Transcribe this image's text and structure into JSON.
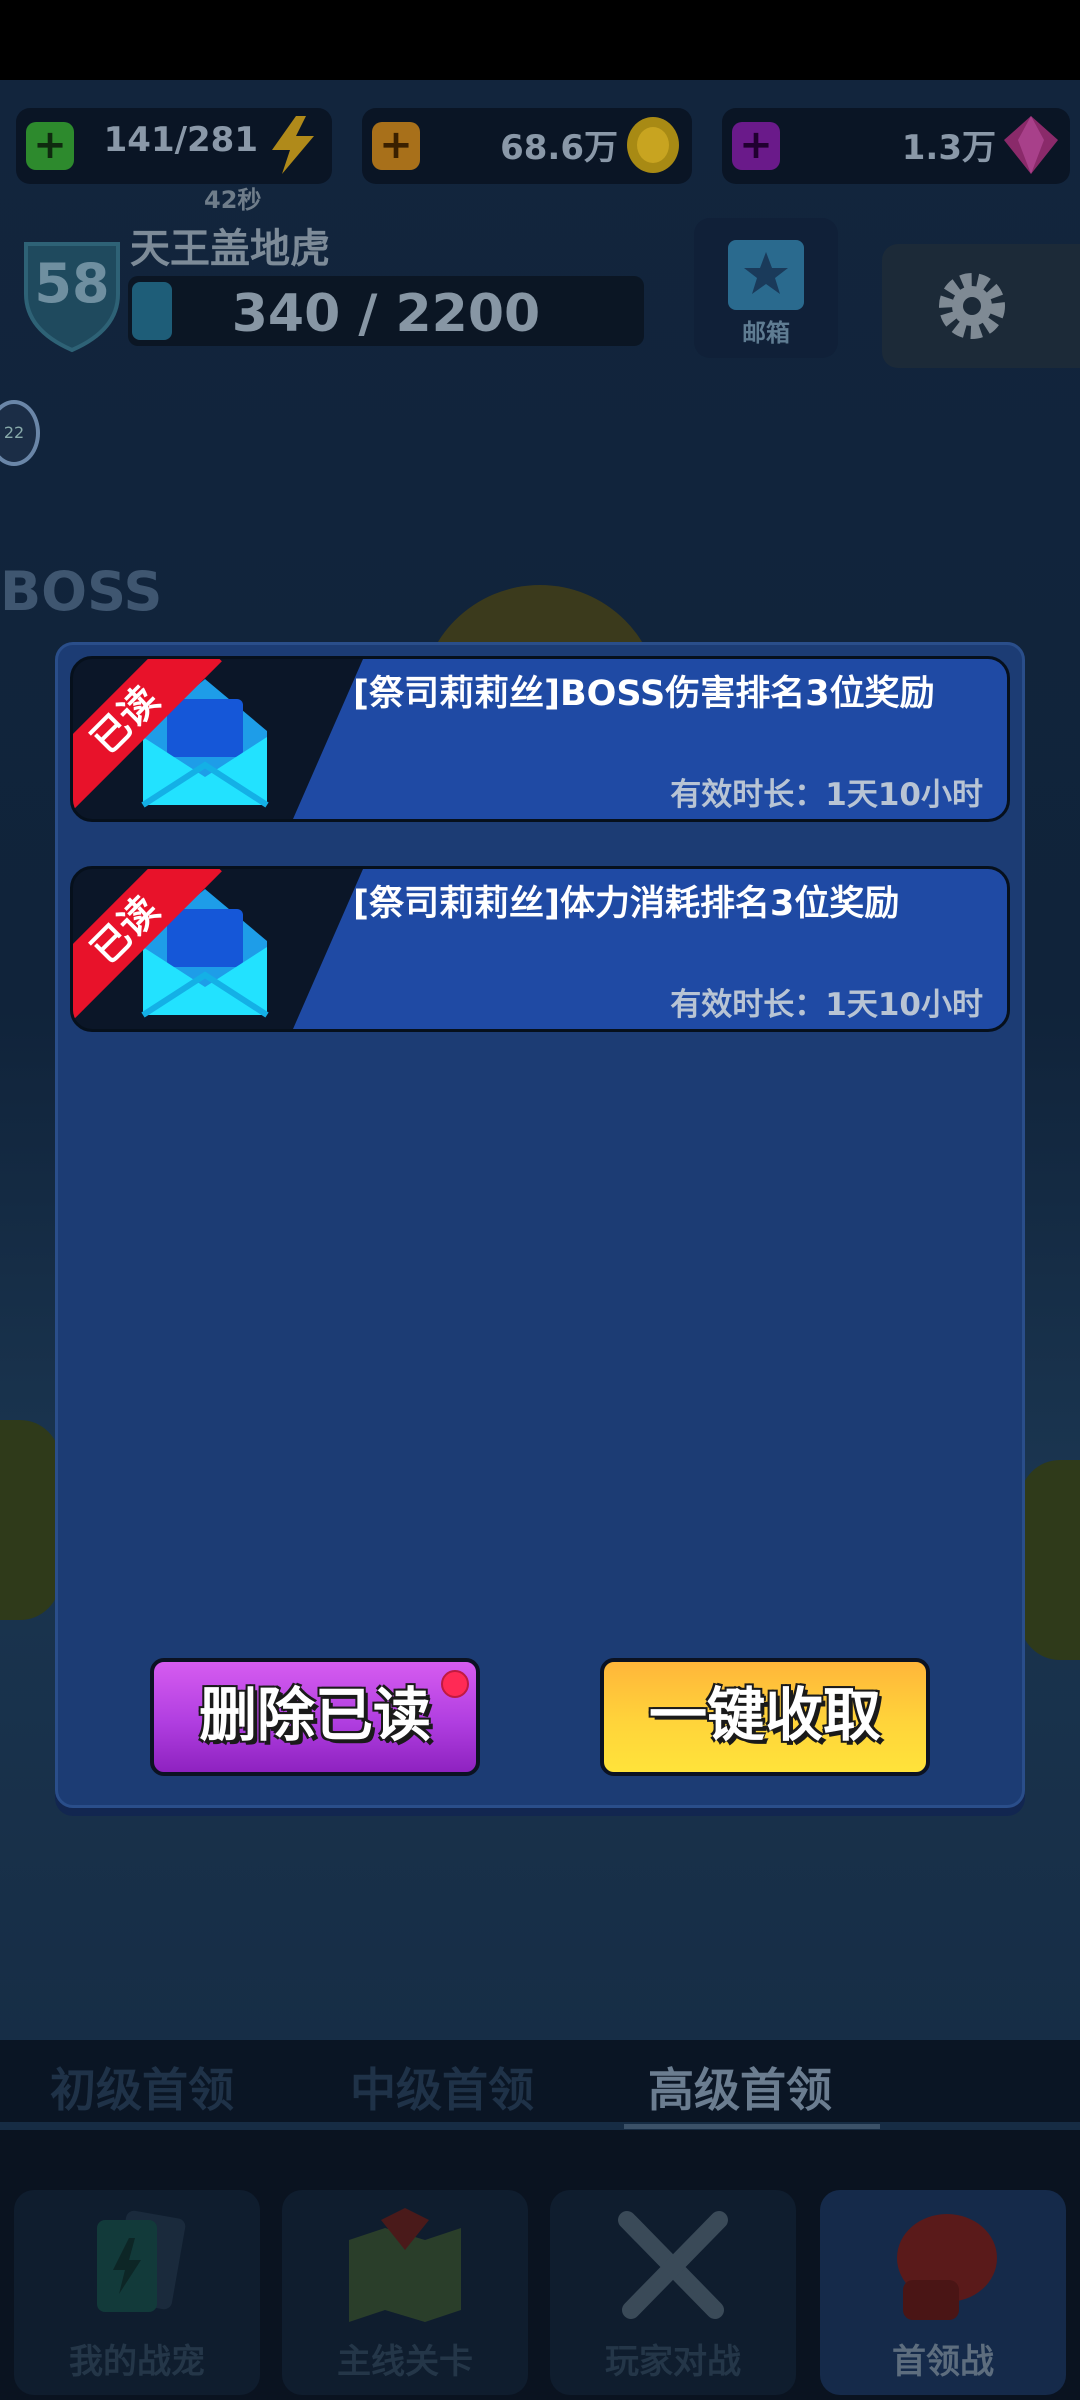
{
  "resources": {
    "energy": {
      "value": "141/281",
      "timer": "42秒"
    },
    "gold": {
      "value": "68.6万"
    },
    "gems": {
      "value": "1.3万"
    }
  },
  "player": {
    "level": "58",
    "name": "天王盖地虎",
    "xp": "340 / 2200"
  },
  "header": {
    "mail_label": "邮箱"
  },
  "side_badge": "22",
  "stage": {
    "boss_label": "BOSS"
  },
  "mailbox": {
    "mails": [
      {
        "status": "已读",
        "title": "[祭司莉莉丝]BOSS伤害排名3位奖励",
        "expiry": "有效时长：1天10小时"
      },
      {
        "status": "已读",
        "title": "[祭司莉莉丝]体力消耗排名3位奖励",
        "expiry": "有效时长：1天10小时"
      }
    ],
    "delete_read_label": "删除已读",
    "collect_all_label": "一键收取"
  },
  "tier_tabs": [
    "初级首领",
    "中级首领",
    "高级首领"
  ],
  "bottom_nav": [
    "我的战宠",
    "主线关卡",
    "玩家对战",
    "首领战"
  ],
  "colors": {
    "dialog_bg": "#1c3c74",
    "read_ribbon": "#e8122a",
    "delete_button": "#b03ee0",
    "collect_button": "#ffd43a"
  }
}
